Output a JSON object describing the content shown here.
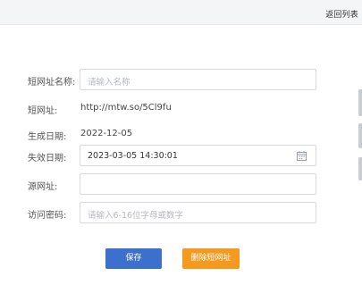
{
  "header": {
    "back_label": "返回列表"
  },
  "form": {
    "name": {
      "label": "短网址名称:",
      "placeholder": "请输入名称",
      "value": ""
    },
    "short_url": {
      "label": "短网址:",
      "value": "http://mtw.so/5Cl9fu"
    },
    "created": {
      "label": "生成日期:",
      "value": "2022-12-05"
    },
    "expires": {
      "label": "失效日期:",
      "value": "2023-03-05 14:30:01",
      "icon": "calendar-icon"
    },
    "source_url": {
      "label": "源网址:",
      "value": ""
    },
    "password": {
      "label": "访问密码:",
      "placeholder": "请输入6-16位字母或数字",
      "value": ""
    }
  },
  "actions": {
    "save_label": "保存",
    "delete_label": "删除短网址"
  },
  "colors": {
    "primary": "#3b70cc",
    "warning": "#f39a1f"
  }
}
